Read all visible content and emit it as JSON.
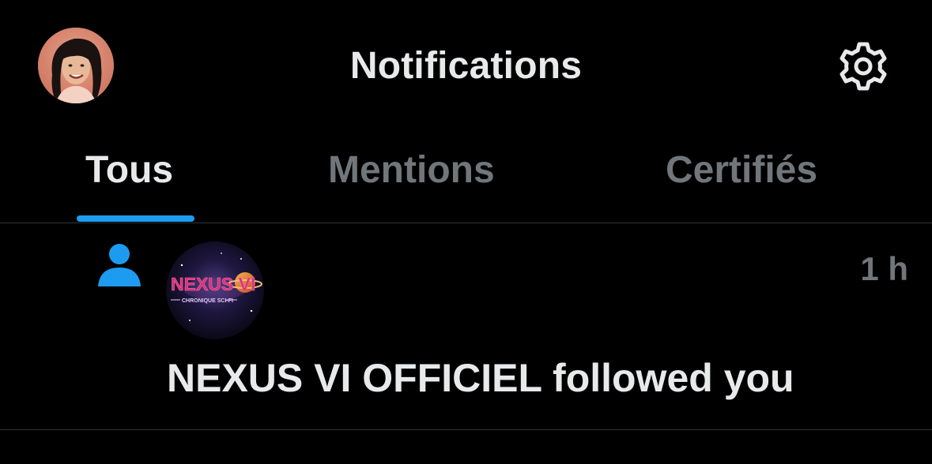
{
  "header": {
    "title": "Notifications",
    "avatar_icon": "user-avatar",
    "settings_icon": "gear-icon"
  },
  "tabs": [
    {
      "label": "Tous",
      "active": true
    },
    {
      "label": "Mentions",
      "active": false
    },
    {
      "label": "Certifiés",
      "active": false
    }
  ],
  "notifications": [
    {
      "type_icon": "person-follow-icon",
      "account_name": "NEXUS VI OFFICIEL",
      "avatar_logo_text": "NEXUS VI",
      "avatar_logo_subtext": "CHRONIQUE SCI-FI",
      "text": "NEXUS VI OFFICIEL followed you",
      "time": "1 h"
    }
  ],
  "colors": {
    "background": "#000000",
    "text_primary": "#e7e9ea",
    "text_secondary": "#71767b",
    "accent": "#1d9bf0",
    "divider": "#2f3336"
  }
}
